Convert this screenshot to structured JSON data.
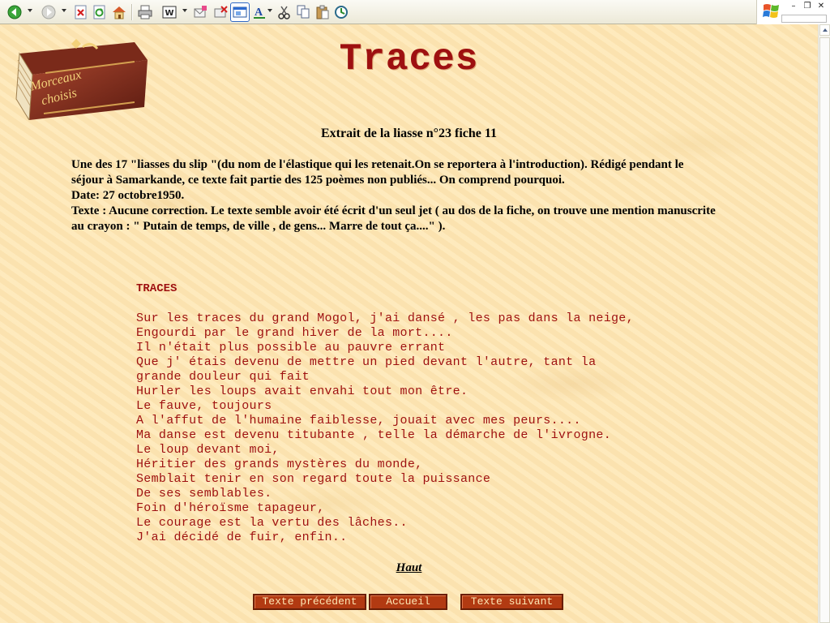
{
  "browser": {
    "toolbar_icons": [
      "back-icon",
      "forward-icon",
      "stop-icon",
      "refresh-icon",
      "home-icon",
      "print-icon",
      "word-icon",
      "email-icon",
      "delete-icon",
      "compatibility-view-icon",
      "font-icon",
      "cut-icon",
      "copy-icon",
      "paste-icon",
      "clock-icon"
    ],
    "window_controls": {
      "minimize": "–",
      "restore": "❐",
      "close": "✕"
    }
  },
  "page": {
    "logo_text": [
      "Morceaux",
      "choisis"
    ],
    "title": "Traces",
    "subtitle": "Extrait de la liasse n°23 fiche 11",
    "intro_lines": [
      "Une des 17 \"liasses du slip \"(du nom de l'élastique qui les retenait.On se reportera à l'introduction). Rédigé pendant le",
      "séjour à Samarkande, ce texte fait partie des 125 poèmes non publiés... On comprend pourquoi.",
      "Date: 27 octobre1950.",
      "Texte : Aucune correction. Le texte semble avoir été écrit d'un seul jet ( au dos de la fiche, on trouve une mention manuscrite",
      "au crayon : \" Putain de temps, de ville , de gens... Marre de tout ça....\" )."
    ],
    "poem_title": "TRACES",
    "poem_lines": [
      "Sur les traces du grand Mogol, j'ai dansé , les pas dans la neige,",
      "Engourdi par le grand hiver de la mort....",
      "Il n'était plus possible au pauvre errant",
      "Que j' étais devenu de mettre un pied devant l'autre, tant la",
      "grande douleur qui fait",
      "Hurler les loups avait envahi tout mon être.",
      "Le fauve, toujours",
      "A l'affut de l'humaine faiblesse, jouait avec mes peurs....",
      "Ma danse est devenu titubante , telle la démarche de l'ivrogne.",
      "Le loup devant moi,",
      "Héritier des grands mystères du monde,",
      "Semblait tenir en son regard toute la puissance",
      "De ses semblables.",
      "Foin d'héroïsme tapageur,",
      "Le courage est la vertu des lâches..",
      "J'ai décidé de fuir, enfin.."
    ],
    "haut_link": "Haut",
    "nav": {
      "prev": "Texte précédent",
      "home": "Accueil",
      "next": "Texte suivant"
    }
  },
  "colors": {
    "text_red": "#9e1010",
    "button_bg": "#b23a12",
    "page_bg": "#fde6b4"
  }
}
